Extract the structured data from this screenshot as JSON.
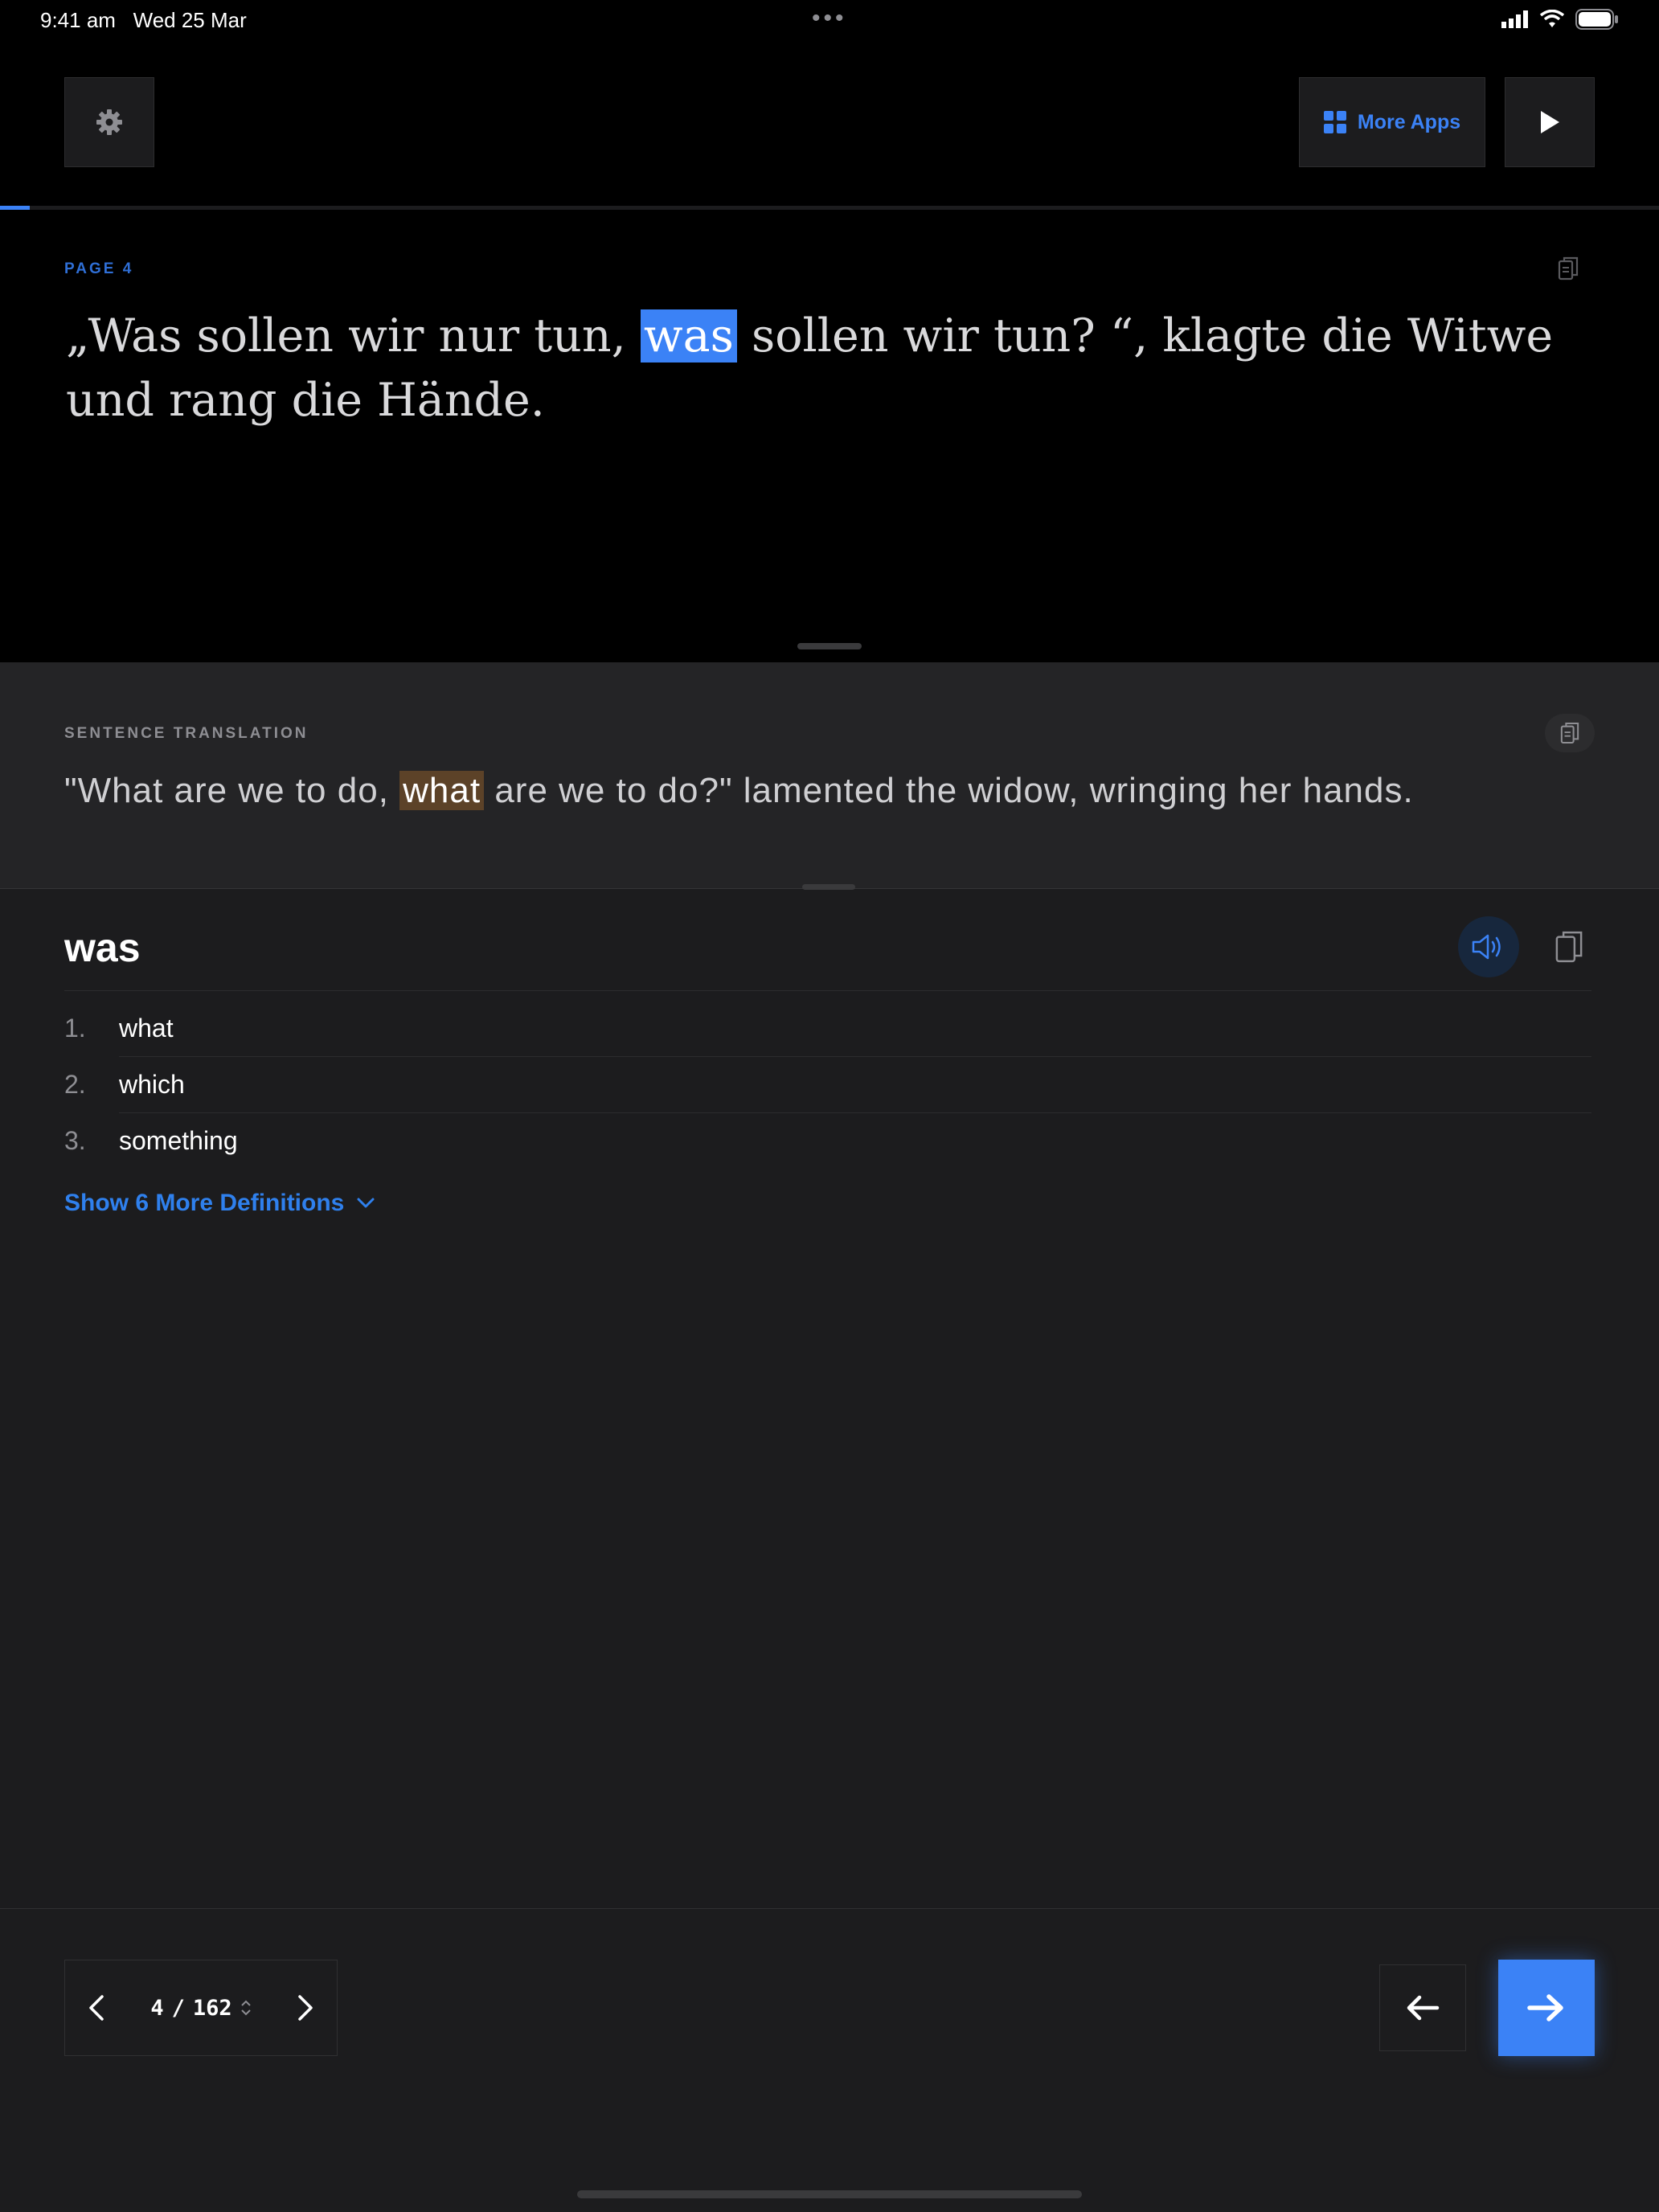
{
  "status_bar": {
    "time": "9:41 am",
    "date": "Wed 25 Mar"
  },
  "toolbar": {
    "more_apps_label": "More Apps"
  },
  "reading": {
    "progress": 0.018
  },
  "passage": {
    "page_label": "PAGE 4",
    "text_before": "„Was sollen wir nur tun, ",
    "highlight": "was",
    "text_after": " sollen wir tun? “, klagte die Witwe und rang die Hände."
  },
  "translation": {
    "label": "SENTENCE TRANSLATION",
    "text_before": "\"What are we to do, ",
    "highlight": "what",
    "text_after": " are we to do?\" lamented the widow, wringing her hands."
  },
  "definition": {
    "word": "was",
    "items": [
      {
        "num": "1.",
        "text": "what"
      },
      {
        "num": "2.",
        "text": "which"
      },
      {
        "num": "3.",
        "text": "something"
      }
    ],
    "show_more_label": "Show 6 More Definitions"
  },
  "pager": {
    "current": "4",
    "separator": "/",
    "total": "162"
  },
  "colors": {
    "accent": "#3b82f6",
    "highlight_translation": "#5c4228",
    "background": "#1c1c1e"
  }
}
